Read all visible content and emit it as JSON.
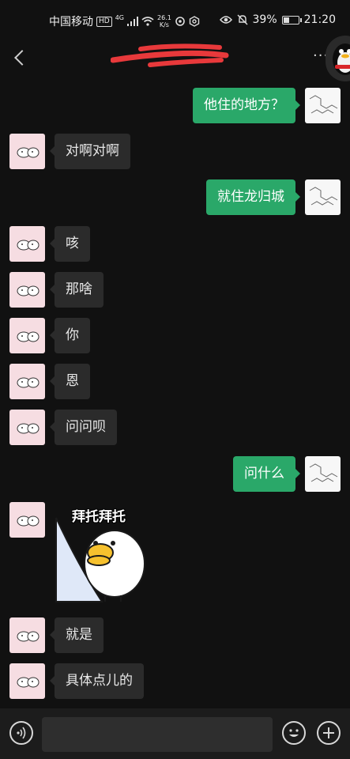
{
  "status_bar": {
    "carrier": "中国移动",
    "hd_badge": "HD",
    "network_type": "4G",
    "net_speed_value": "26.1",
    "net_speed_unit": "K/s",
    "battery_percent": "39%",
    "battery_level": 0.39,
    "time": "21:20",
    "icons": [
      "signal-icon",
      "wifi-icon",
      "sync-icon",
      "settings-icon",
      "eye-icon",
      "mute-bell-icon",
      "battery-icon"
    ]
  },
  "header": {
    "back_icon": "back-chevron-icon",
    "more_label": "···",
    "title_redacted": true
  },
  "messages": [
    {
      "side": "right",
      "type": "text",
      "text": "他住的地方？"
    },
    {
      "side": "left",
      "type": "text",
      "text": "对啊对啊"
    },
    {
      "side": "right",
      "type": "text",
      "text": "就住龙归城"
    },
    {
      "side": "left",
      "type": "text",
      "text": "咳"
    },
    {
      "side": "left",
      "type": "text",
      "text": "那啥"
    },
    {
      "side": "left",
      "type": "text",
      "text": "你"
    },
    {
      "side": "left",
      "type": "text",
      "text": "恩"
    },
    {
      "side": "left",
      "type": "text",
      "text": "问问呗"
    },
    {
      "side": "right",
      "type": "text",
      "text": "问什么"
    },
    {
      "side": "left",
      "type": "sticker",
      "caption": "拜托拜托"
    },
    {
      "side": "left",
      "type": "text",
      "text": "就是"
    },
    {
      "side": "left",
      "type": "text",
      "text": "具体点儿的"
    }
  ],
  "input_bar": {
    "placeholder": "",
    "icons": [
      "voice-icon",
      "emoji-icon",
      "plus-icon"
    ]
  },
  "colors": {
    "background": "#111111",
    "bubble_incoming": "#2b2b2b",
    "bubble_outgoing": "#2aa869",
    "input_bar": "#1c1c1c"
  }
}
